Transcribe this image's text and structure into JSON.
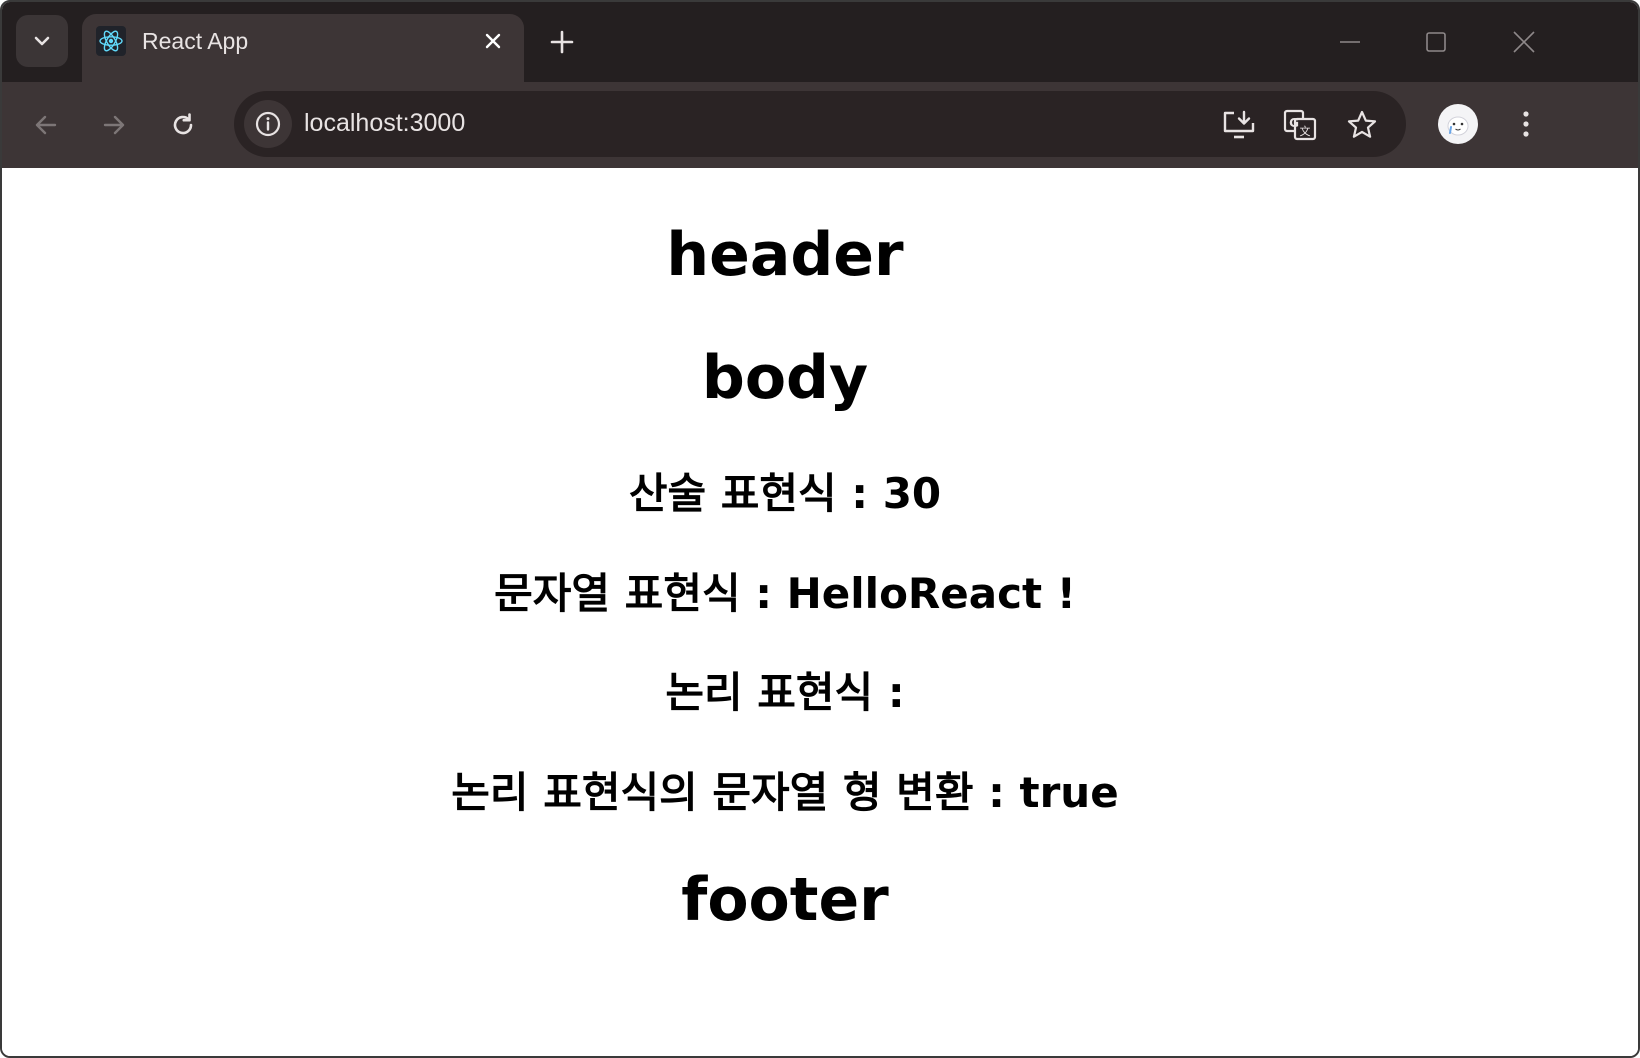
{
  "browser": {
    "tab": {
      "title": "React App"
    },
    "address_bar": {
      "url": "localhost:3000"
    },
    "colors": {
      "tabstrip": "#241f20",
      "toolbar": "#3d3536",
      "omnibox": "#2a2324",
      "react_logo": "#61dafb"
    }
  },
  "page": {
    "header": "header",
    "body": "body",
    "arithmetic": "산술 표현식 : 30",
    "string": "문자열 표현식 : HelloReact !",
    "logical": "논리 표현식 :",
    "logical_to_string": "논리 표현식의 문자열 형 변환 : true",
    "footer": "footer"
  },
  "icons": {
    "tab_search": "chevron-down-icon",
    "favicon": "react-logo-icon",
    "tab_close": "close-icon",
    "new_tab": "plus-icon",
    "minimize": "minimize-icon",
    "maximize": "maximize-icon",
    "close_window": "close-icon",
    "back": "arrow-left-icon",
    "forward": "arrow-right-icon",
    "reload": "reload-icon",
    "site_info": "info-icon",
    "install": "install-app-icon",
    "translate": "translate-icon",
    "bookmark": "star-icon",
    "profile": "avatar-icon",
    "menu": "kebab-menu-icon"
  }
}
